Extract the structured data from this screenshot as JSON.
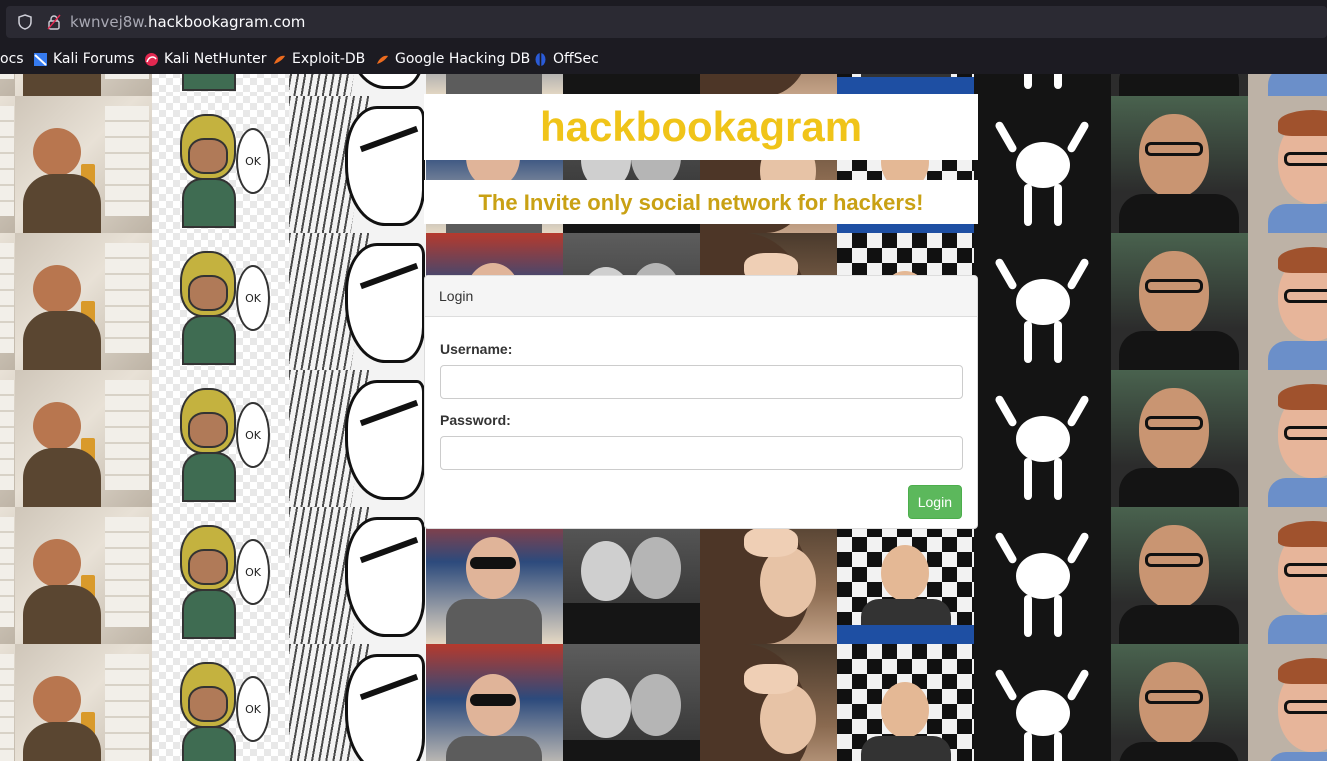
{
  "browser": {
    "url_subdomain": "kwnvej8w.",
    "url_domain": "hackbookagram.com",
    "bookmarks": [
      {
        "label": "ocs",
        "icon": "docs-icon"
      },
      {
        "label": "Kali Forums",
        "icon": "kali-forums-icon"
      },
      {
        "label": "Kali NetHunter",
        "icon": "kali-nethunter-icon"
      },
      {
        "label": "Exploit-DB",
        "icon": "exploit-db-icon"
      },
      {
        "label": "Google Hacking DB",
        "icon": "google-hacking-db-icon"
      },
      {
        "label": "OffSec",
        "icon": "offsec-icon"
      }
    ]
  },
  "site": {
    "title": "hackbookagram",
    "tagline": "The Invite only social network for hackers!"
  },
  "login": {
    "panel_title": "Login",
    "username_label": "Username:",
    "username_value": "",
    "password_label": "Password:",
    "password_value": "",
    "submit_label": "Login"
  },
  "background": {
    "tile_ok_text": "OK"
  },
  "colors": {
    "title": "#f0c419",
    "tagline": "#c9a114",
    "button": "#5cb85c"
  }
}
